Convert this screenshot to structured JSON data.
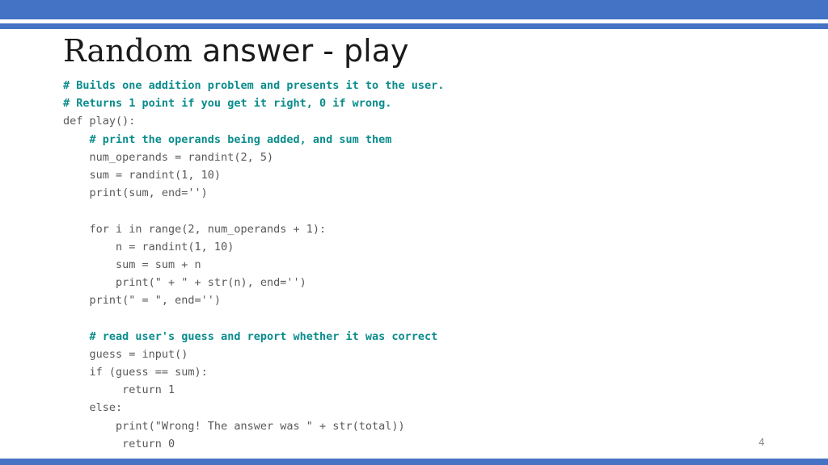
{
  "theme": {
    "accent_color": "#4472C4",
    "comment_color": "#0B8C8C",
    "code_color": "#595959",
    "title_color": "#1A1A1A",
    "page_number_color": "#8A8A8A",
    "background_color": "#FFFFFF"
  },
  "title": {
    "full": "Random answer - play",
    "part_serif": "Random",
    "part_sans": " answer - play"
  },
  "code": {
    "language": "python",
    "lines": [
      {
        "text": "# Builds one addition problem and presents it to the user.",
        "kind": "comment"
      },
      {
        "text": "# Returns 1 point if you get it right, 0 if wrong.",
        "kind": "comment"
      },
      {
        "text": "def play():",
        "kind": "code"
      },
      {
        "text": "    # print the operands being added, and sum them",
        "kind": "comment"
      },
      {
        "text": "    num_operands = randint(2, 5)",
        "kind": "code"
      },
      {
        "text": "    sum = randint(1, 10)",
        "kind": "code"
      },
      {
        "text": "    print(sum, end='')",
        "kind": "code"
      },
      {
        "text": "",
        "kind": "blank"
      },
      {
        "text": "    for i in range(2, num_operands + 1):",
        "kind": "code"
      },
      {
        "text": "        n = randint(1, 10)",
        "kind": "code"
      },
      {
        "text": "        sum = sum + n",
        "kind": "code"
      },
      {
        "text": "        print(\" + \" + str(n), end='')",
        "kind": "code"
      },
      {
        "text": "    print(\" = \", end='')",
        "kind": "code"
      },
      {
        "text": "",
        "kind": "blank"
      },
      {
        "text": "    # read user's guess and report whether it was correct",
        "kind": "comment"
      },
      {
        "text": "    guess = input()",
        "kind": "code"
      },
      {
        "text": "    if (guess == sum):",
        "kind": "code"
      },
      {
        "text": "         return 1",
        "kind": "code"
      },
      {
        "text": "    else:",
        "kind": "code"
      },
      {
        "text": "        print(\"Wrong! The answer was \" + str(total))",
        "kind": "code"
      },
      {
        "text": "         return 0",
        "kind": "code"
      }
    ]
  },
  "footer": {
    "page_number": "4"
  }
}
